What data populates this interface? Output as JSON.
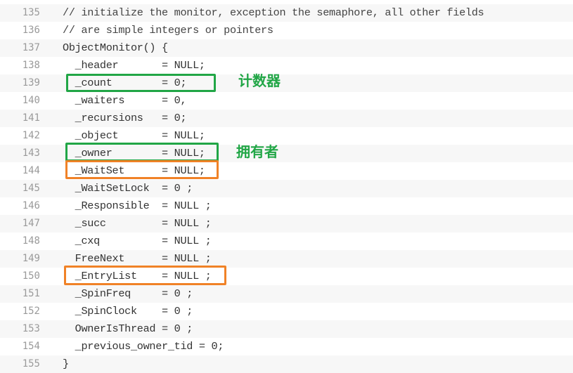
{
  "colors": {
    "green": "#21a646",
    "orange": "#f08227"
  },
  "lines": [
    {
      "num": "135",
      "code": "// initialize the monitor, exception the semaphore, all other fields"
    },
    {
      "num": "136",
      "code": "// are simple integers or pointers"
    },
    {
      "num": "137",
      "code": "ObjectMonitor() {"
    },
    {
      "num": "138",
      "code": "  _header       = NULL;"
    },
    {
      "num": "139",
      "code": "  _count        = 0;"
    },
    {
      "num": "140",
      "code": "  _waiters      = 0,"
    },
    {
      "num": "141",
      "code": "  _recursions   = 0;"
    },
    {
      "num": "142",
      "code": "  _object       = NULL;"
    },
    {
      "num": "143",
      "code": "  _owner        = NULL;"
    },
    {
      "num": "144",
      "code": "  _WaitSet      = NULL;"
    },
    {
      "num": "145",
      "code": "  _WaitSetLock  = 0 ;"
    },
    {
      "num": "146",
      "code": "  _Responsible  = NULL ;"
    },
    {
      "num": "147",
      "code": "  _succ         = NULL ;"
    },
    {
      "num": "148",
      "code": "  _cxq          = NULL ;"
    },
    {
      "num": "149",
      "code": "  FreeNext      = NULL ;"
    },
    {
      "num": "150",
      "code": "  _EntryList    = NULL ;"
    },
    {
      "num": "151",
      "code": "  _SpinFreq     = 0 ;"
    },
    {
      "num": "152",
      "code": "  _SpinClock    = 0 ;"
    },
    {
      "num": "153",
      "code": "  OwnerIsThread = 0 ;"
    },
    {
      "num": "154",
      "code": "  _previous_owner_tid = 0;"
    },
    {
      "num": "155",
      "code": "}"
    }
  ],
  "annotations": {
    "counter_label": "计数器",
    "owner_label": "拥有者"
  }
}
